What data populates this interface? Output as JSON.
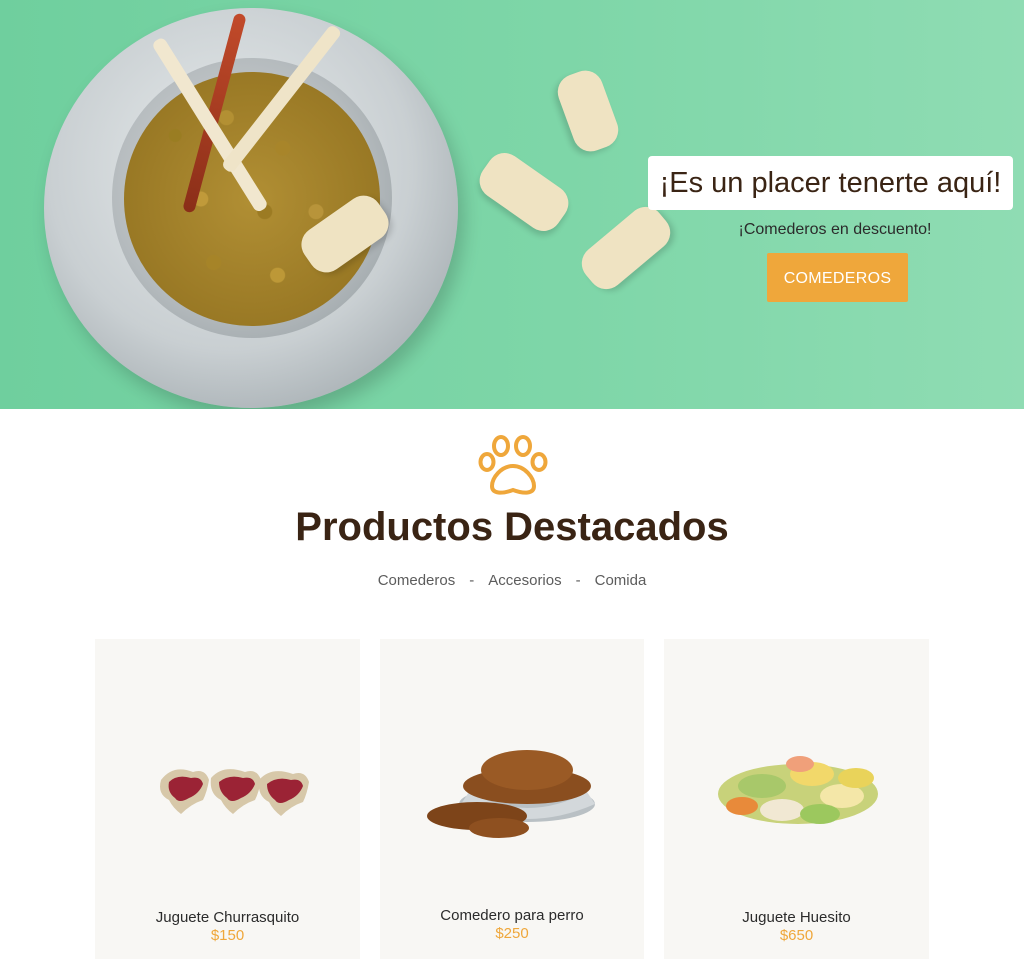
{
  "hero": {
    "title": "¡Es un placer tenerte aquí!",
    "subtitle": "¡Comederos en descuento!",
    "button_label": "COMEDEROS"
  },
  "featured": {
    "icon": "paw-icon",
    "title": "Productos Destacados",
    "filters": [
      "Comederos",
      "Accesorios",
      "Comida"
    ],
    "separator": "-"
  },
  "products": [
    {
      "name": "Juguete Churrasquito",
      "price": "$150",
      "image": "steak-toy-image"
    },
    {
      "name": "Comedero para perro",
      "price": "$250",
      "image": "food-bowl-image"
    },
    {
      "name": "Juguete Huesito",
      "price": "$650",
      "image": "bone-biscuits-image"
    }
  ],
  "colors": {
    "accent": "#efa73b",
    "hero_bg": "#7ed6a8",
    "text_dark": "#3a2414"
  }
}
